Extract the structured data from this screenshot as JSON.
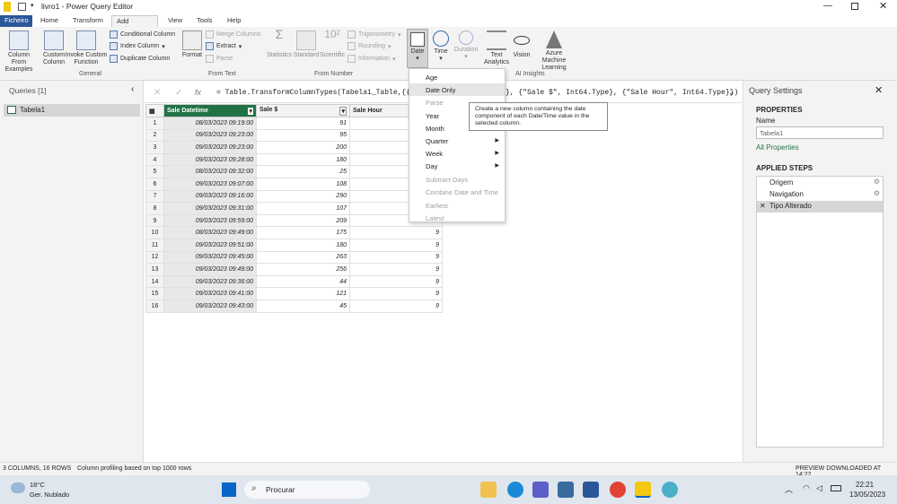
{
  "window": {
    "title": "livro1 - Power Query Editor"
  },
  "tabs": [
    "Ficheiro",
    "Home",
    "Transform",
    "Add Column",
    "View",
    "Tools",
    "Help"
  ],
  "ribbon": {
    "general": {
      "group_label": "General",
      "column_from_examples": "Column From Examples",
      "custom_column": "Custom Column",
      "invoke_custom_function": "Invoke Custom Function",
      "conditional_column": "Conditional Column",
      "index_column": "Index Column",
      "duplicate_column": "Duplicate Column"
    },
    "from_text": {
      "group_label": "From Text",
      "format": "Format",
      "merge_columns": "Merge Columns",
      "extract": "Extract",
      "parse": "Parse"
    },
    "from_number": {
      "group_label": "From Number",
      "statistics": "Statistics",
      "standard": "Standard",
      "scientific": "Scientific",
      "trigonometry": "Trigonometry",
      "rounding": "Rounding",
      "information": "Information"
    },
    "from_date": {
      "date": "Date",
      "time": "Time",
      "duration": "Duration"
    },
    "ai": {
      "group_label": "AI Insights",
      "text_analytics": "Text Analytics",
      "vision": "Vision",
      "azure_ml": "Azure Machine Learning"
    }
  },
  "queries": {
    "header": "Queries [1]",
    "items": [
      "Tabela1"
    ]
  },
  "formula": {
    "text": "= Table.TransformColumnTypes(Tabela1_Table,{{\"Sale"
  },
  "formula_tail": "}, {\"Sale $\", Int64.Type}, {\"Sale Hour\", Int64.Type}})",
  "table": {
    "columns": [
      "Sale Datetime",
      "Sale $",
      "Sale Hour"
    ],
    "rows": [
      [
        "08/03/2023 09:19:00",
        "91",
        ""
      ],
      [
        "09/03/2023 09:23:00",
        "95",
        ""
      ],
      [
        "09/03/2023 09:23:00",
        "200",
        ""
      ],
      [
        "09/03/2023 09:28:00",
        "180",
        ""
      ],
      [
        "08/03/2023 09:32:00",
        "25",
        ""
      ],
      [
        "09/03/2023 09:07:00",
        "108",
        "9"
      ],
      [
        "09/03/2023 09:16:00",
        "290",
        "9"
      ],
      [
        "09/03/2023 09:31:00",
        "107",
        "9"
      ],
      [
        "09/03/2023 09:59:00",
        "209",
        "9"
      ],
      [
        "08/03/2023 09:49:00",
        "175",
        "9"
      ],
      [
        "09/03/2023 09:51:00",
        "180",
        "9"
      ],
      [
        "09/03/2023 09:45:00",
        "263",
        "9"
      ],
      [
        "09/03/2023 09:49:00",
        "256",
        "9"
      ],
      [
        "09/03/2023 09:36:00",
        "44",
        "9"
      ],
      [
        "09/03/2023 09:41:00",
        "121",
        "9"
      ],
      [
        "09/03/2023 09:43:00",
        "45",
        "9"
      ]
    ]
  },
  "date_menu": [
    {
      "label": "Age",
      "disabled": false,
      "sub": false
    },
    {
      "label": "Date Only",
      "disabled": false,
      "sub": false,
      "highlight": true
    },
    {
      "label": "Parse",
      "disabled": true,
      "sub": false
    },
    {
      "label": "Year",
      "disabled": false,
      "sub": true
    },
    {
      "label": "Month",
      "disabled": false,
      "sub": true
    },
    {
      "label": "Quarter",
      "disabled": false,
      "sub": true
    },
    {
      "label": "Week",
      "disabled": false,
      "sub": true
    },
    {
      "label": "Day",
      "disabled": false,
      "sub": true
    },
    {
      "label": "Subtract Days",
      "disabled": true,
      "sub": false
    },
    {
      "label": "Combine Date and Time",
      "disabled": true,
      "sub": false
    },
    {
      "label": "Earliest",
      "disabled": true,
      "sub": false
    },
    {
      "label": "Latest",
      "disabled": true,
      "sub": false
    }
  ],
  "tooltip": "Create a new column containing the date component of each Date/Time value in the selected column.",
  "settings": {
    "title": "Query Settings",
    "properties": "PROPERTIES",
    "name_label": "Name",
    "name_value": "Tabela1",
    "all_properties": "All Properties",
    "applied_steps": "APPLIED STEPS",
    "steps": [
      "Origem",
      "Navigation",
      "Tipo Alterado"
    ]
  },
  "status": {
    "left": "3 COLUMNS, 16 ROWS",
    "profiling": "Column profiling based on top 1000 rows",
    "right": "PREVIEW DOWNLOADED AT 14:22"
  },
  "taskbar": {
    "temp": "18°C",
    "weather": "Ger. Nublado",
    "search": "Procurar",
    "time": "22:21",
    "date": "13/05/2023"
  },
  "colors": {
    "file_tab": "#2b579a",
    "accent": "#217346",
    "selected_header": "#217346"
  }
}
